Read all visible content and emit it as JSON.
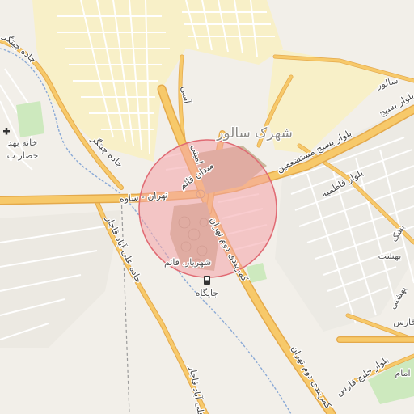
{
  "map": {
    "place_labels": {
      "shahrak_salur": "شهرک سالور",
      "salur": "سالور",
      "basij_blvd_top": "بلوار بسیج",
      "basij_blvd_mostazafin": "بلوار بسیج مستضعفین",
      "blvd_fatemiyeh": "بلوار فاطمیه",
      "tehran_saveh": "تهران - ساوه",
      "maidan_ghaem": "میدان قائم",
      "shahriar_ghaem": "شهریار، قائم",
      "station": "جایگاه",
      "kamarbandi_2_tehran": "کمربندی دوم تهران",
      "kamarbandi_2_tehran_lower": "کمربندی دوم تهران",
      "jadeh_chitgar_top": "جاده چیتگر",
      "jadeh_chitgar": "جاده چیتگر",
      "jadeh_ali_abad": "جاده علی آباد قاجار",
      "ali_abad_lower": "علی آباد قاجار",
      "amini": "امینی",
      "asi": "آسی",
      "khaneh_behdasht": "خانه بهد",
      "hesar_b": "حصار ب",
      "blvd_khalij_fars": "بلوار خلیج فارس",
      "behesht": "بهشت",
      "behesht2": "بهشتی",
      "emam": "امام",
      "fars_right": "فارس",
      "taghi_right": "تقی",
      "bashgah": "بشک"
    },
    "icons": {
      "hospital": "hospital-cross-icon",
      "fuel": "fuel-pump-icon"
    },
    "colors": {
      "background": "#f2efe9",
      "residential": "#f8f0c8",
      "major_road": "#f7c96a",
      "major_road_casing": "#e4a94b",
      "minor_road": "#ffffff",
      "green": "#cde9be",
      "water": "#8aa9d6",
      "highlight_fill": "#f4a3a8",
      "highlight_stroke": "#e06a73"
    }
  }
}
